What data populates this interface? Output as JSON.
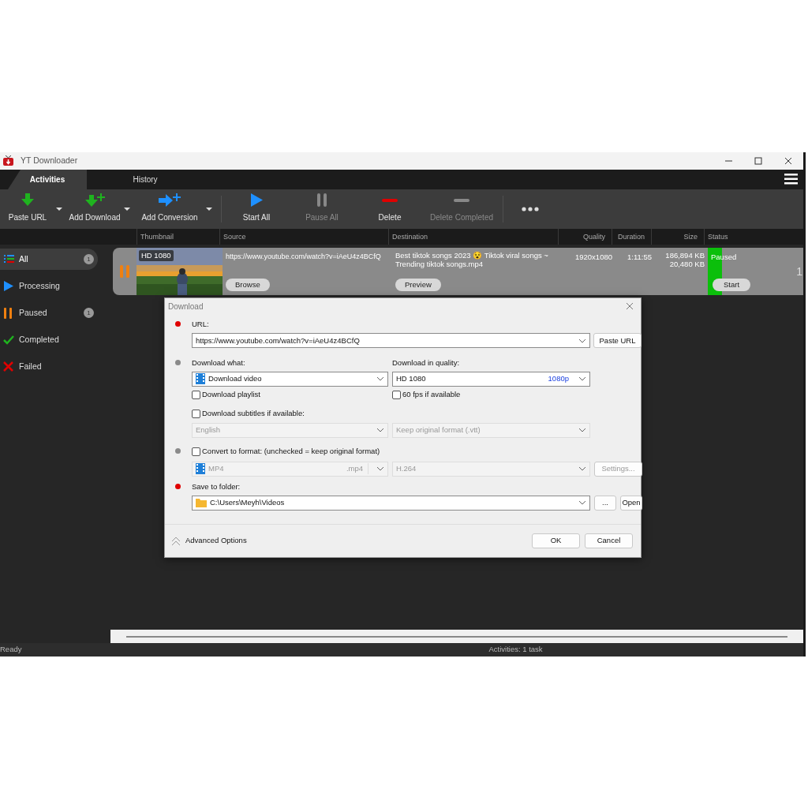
{
  "window": {
    "title": "YT Downloader"
  },
  "tabs": [
    {
      "label": "Activities",
      "selected": true
    },
    {
      "label": "History",
      "selected": false
    }
  ],
  "toolbar": [
    {
      "label": "Paste URL",
      "kind": "paste",
      "disabled": false,
      "dropdown": true
    },
    {
      "label": "Add Download",
      "kind": "add-download",
      "disabled": false,
      "dropdown": true
    },
    {
      "label": "Add Conversion",
      "kind": "add-conversion",
      "disabled": false,
      "dropdown": true
    },
    {
      "label": "Start All",
      "kind": "start",
      "disabled": false,
      "dropdown": false
    },
    {
      "label": "Pause All",
      "kind": "pause",
      "disabled": true,
      "dropdown": false
    },
    {
      "label": "Delete",
      "kind": "delete",
      "disabled": false,
      "dropdown": false
    },
    {
      "label": "Delete Completed",
      "kind": "delete-completed",
      "disabled": true,
      "dropdown": false
    }
  ],
  "sidebar": {
    "items": [
      {
        "label": "All",
        "kind": "all",
        "count": "1",
        "selected": true
      },
      {
        "label": "Processing",
        "kind": "processing",
        "selected": false
      },
      {
        "label": "Paused",
        "kind": "paused",
        "count": "1",
        "selected": false
      },
      {
        "label": "Completed",
        "kind": "completed",
        "selected": false
      },
      {
        "label": "Failed",
        "kind": "failed",
        "selected": false
      }
    ]
  },
  "table": {
    "columns": [
      "Thumbnail",
      "Source",
      "Destination",
      "Quality",
      "Duration",
      "Size",
      "Status"
    ],
    "rows": [
      {
        "paused": true,
        "badge": "HD 1080",
        "source": "https://www.youtube.com/watch?v=iAeU4z4BCfQ",
        "source_button": "Browse",
        "destination": "Best tiktok songs 2023 😵 Tiktok viral songs ~ Trending tiktok songs.mp4",
        "destination_button": "Preview",
        "quality": "1920x1080",
        "duration": "1:11:55",
        "size": [
          "186,894 KB",
          "20,480 KB"
        ],
        "status": "Paused",
        "status_button": "Start",
        "edge_text": "1"
      }
    ]
  },
  "dialog": {
    "title": "Download",
    "sections": [
      {
        "kind": "url",
        "color": "#e00000",
        "label": "URL:",
        "value": "https://www.youtube.com/watch?v=iAeU4z4BCfQ",
        "button": "Paste URL"
      },
      {
        "kind": "what",
        "color": "#8a8a8a",
        "label": "Download what:",
        "value": "Download video",
        "quality_label": "Download in quality:",
        "quality_value": "HD 1080",
        "quality_tag": "1080p",
        "playlist": {
          "label": "Download playlist",
          "checked": false
        },
        "fps": {
          "label": "60 fps if available",
          "checked": false
        },
        "subtitles": {
          "label": "Download subtitles if available:",
          "checked": false
        },
        "subtitle_language": {
          "value": "English",
          "disabled": true
        },
        "subtitle_format": {
          "value": "Keep original format (.vtt)",
          "disabled": true
        }
      },
      {
        "kind": "convert",
        "color": "#8a8a8a",
        "convert": {
          "label": "Convert to format: (unchecked = keep original format)",
          "checked": false
        },
        "format": {
          "value": "MP4",
          "ext": ".mp4",
          "disabled": true
        },
        "codec": {
          "value": "H.264",
          "disabled": true
        },
        "button": {
          "label": "Settings...",
          "disabled": true
        }
      },
      {
        "kind": "folder",
        "color": "#e00000",
        "label": "Save to folder:",
        "value": "C:\\Users\\Meyh\\Videos",
        "buttons": [
          "...",
          "Open"
        ]
      }
    ],
    "advanced": "Advanced Options",
    "buttons": [
      "OK",
      "Cancel"
    ]
  },
  "status_bar": {
    "left": "Ready",
    "center": "Activities: 1 task"
  }
}
